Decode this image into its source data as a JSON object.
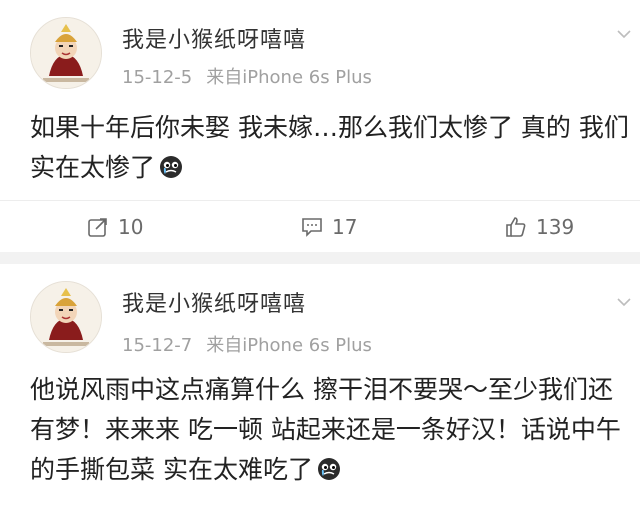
{
  "posts": [
    {
      "username": "我是小猴纸呀嘻嘻",
      "date": "15-12-5",
      "source": "来自iPhone 6s Plus",
      "content": "如果十年后你未娶 我未嫁…那么我们太惨了 真的 我们实在太惨了",
      "emoji": "crying-face-icon",
      "actions": {
        "repost_count": "10",
        "comment_count": "17",
        "like_count": "139"
      }
    },
    {
      "username": "我是小猴纸呀嘻嘻",
      "date": "15-12-7",
      "source": "来自iPhone 6s Plus",
      "content": "他说风雨中这点痛算什么 擦干泪不要哭～至少我们还有梦！来来来 吃一顿 站起来还是一条好汉！话说中午的手撕包菜 实在太难吃了",
      "emoji": "crying-face-icon"
    }
  ]
}
